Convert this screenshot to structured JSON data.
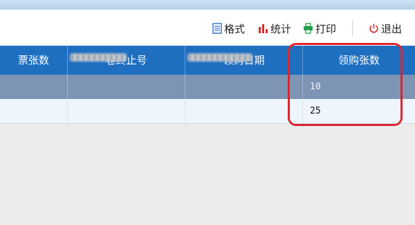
{
  "toolbar": {
    "format_label": "格式",
    "stats_label": "统计",
    "print_label": "打印",
    "exit_label": "退出"
  },
  "table": {
    "columns": [
      "票张数",
      "卷终止号",
      "领购日期",
      "领购张数"
    ],
    "rows": [
      {
        "purchase_count": "10"
      },
      {
        "purchase_count": "25"
      }
    ]
  },
  "colors": {
    "header_bg": "#1f6fc0",
    "selected_row_bg": "#7d94b4",
    "highlight": "#e0242b"
  },
  "icons": [
    "format-icon",
    "stats-icon",
    "print-icon",
    "power-icon"
  ]
}
